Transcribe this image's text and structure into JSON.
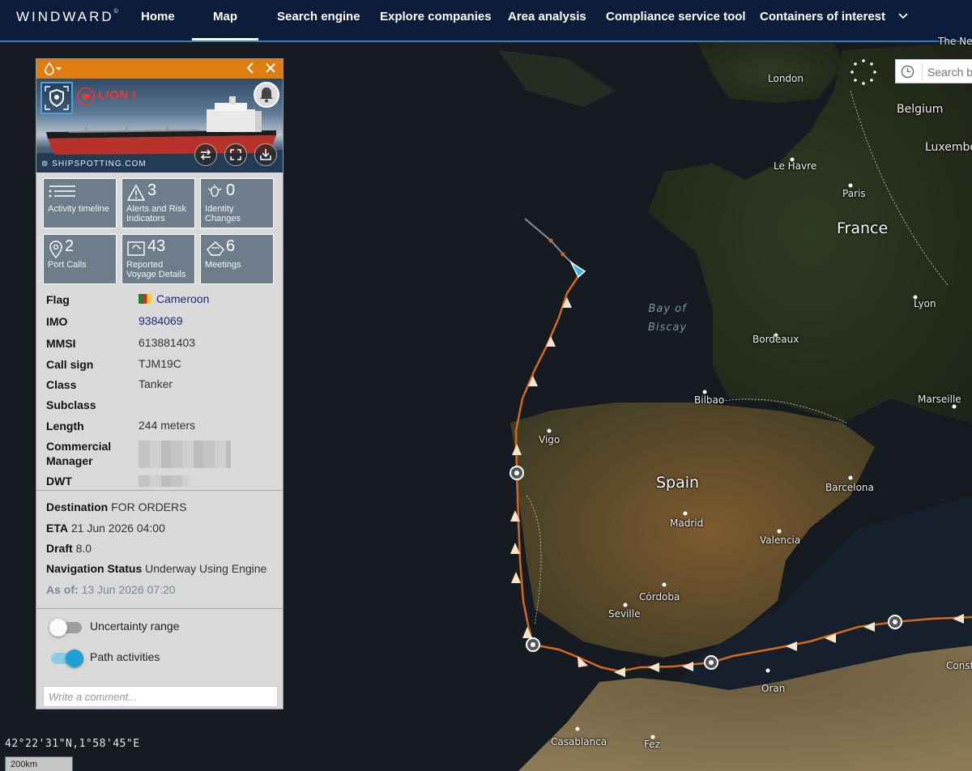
{
  "nav": {
    "logo": "WINDWARD",
    "logo_mark": "©",
    "items": [
      "Home",
      "Map",
      "Search engine",
      "Explore companies",
      "Area analysis",
      "Compliance service tool",
      "Containers of interest"
    ],
    "active": "Map"
  },
  "map": {
    "search_placeholder": "Search b",
    "labels": {
      "london": "London",
      "netherlands": "The Netherland",
      "belgium": "Belgium",
      "luxembourg": "Luxembo",
      "le_havre": "Le Havre",
      "paris": "Paris",
      "france": "France",
      "lyon": "Lyon",
      "bordeaux": "Bordeaux",
      "bay_of_biscay_1": "Bay of",
      "bay_of_biscay_2": "Biscay",
      "bilbao": "Bilbao",
      "marseille": "Marseille",
      "vigo": "Vigo",
      "spain": "Spain",
      "madrid": "Madrid",
      "barcelona": "Barcelona",
      "valencia": "Valencia",
      "cordoba": "Córdoba",
      "seville": "Seville",
      "oran": "Oran",
      "casablanca": "Casablanca",
      "fez": "Fez",
      "constantine": "Const"
    },
    "coordinates": "42°22'31\"N,1°58'45\"E",
    "scale": "200km"
  },
  "vessel": {
    "name": "LION I",
    "image_credit": "SHIPSPOTTING.COM",
    "tiles": [
      {
        "number": "",
        "label": "Activity timeline"
      },
      {
        "number": "3",
        "label": "Alerts and Risk Indicators"
      },
      {
        "number": "0",
        "label": "Identity Changes"
      },
      {
        "number": "2",
        "label": "Port Calls"
      },
      {
        "number": "43",
        "label": "Reported Voyage Details"
      },
      {
        "number": "6",
        "label": "Meetings"
      }
    ],
    "details": {
      "flag_label": "Flag",
      "flag": "Cameroon",
      "imo_label": "IMO",
      "imo": "9384069",
      "mmsi_label": "MMSI",
      "mmsi": "613881403",
      "callsign_label": "Call sign",
      "callsign": "TJM19C",
      "class_label": "Class",
      "class": "Tanker",
      "subclass_label": "Subclass",
      "subclass": "",
      "length_label": "Length",
      "length": "244 meters",
      "manager_label": "Commercial Manager",
      "dwt_label": "DWT"
    },
    "voyage": {
      "destination_label": "Destination",
      "destination": "FOR ORDERS",
      "eta_label": "ETA",
      "eta": "21 Jun 2026 04:00",
      "draft_label": "Draft",
      "draft": "8.0",
      "nav_status_label": "Navigation Status",
      "nav_status": "Underway Using Engine",
      "as_of_label": "As of:",
      "as_of": "13 Jun 2026 07:20"
    },
    "toggles": {
      "uncertainty_label": "Uncertainty range",
      "uncertainty_on": false,
      "path_label": "Path activities",
      "path_on": true
    },
    "comment_placeholder": "Write a comment..."
  },
  "colors": {
    "nav_bg": "#0c1d3c",
    "panel_header": "#e07d10",
    "track": "#d2691e",
    "tile_bg": "#6e7d8b",
    "vessel_name": "#e53935",
    "toggle_on": "#1e9fd6"
  }
}
